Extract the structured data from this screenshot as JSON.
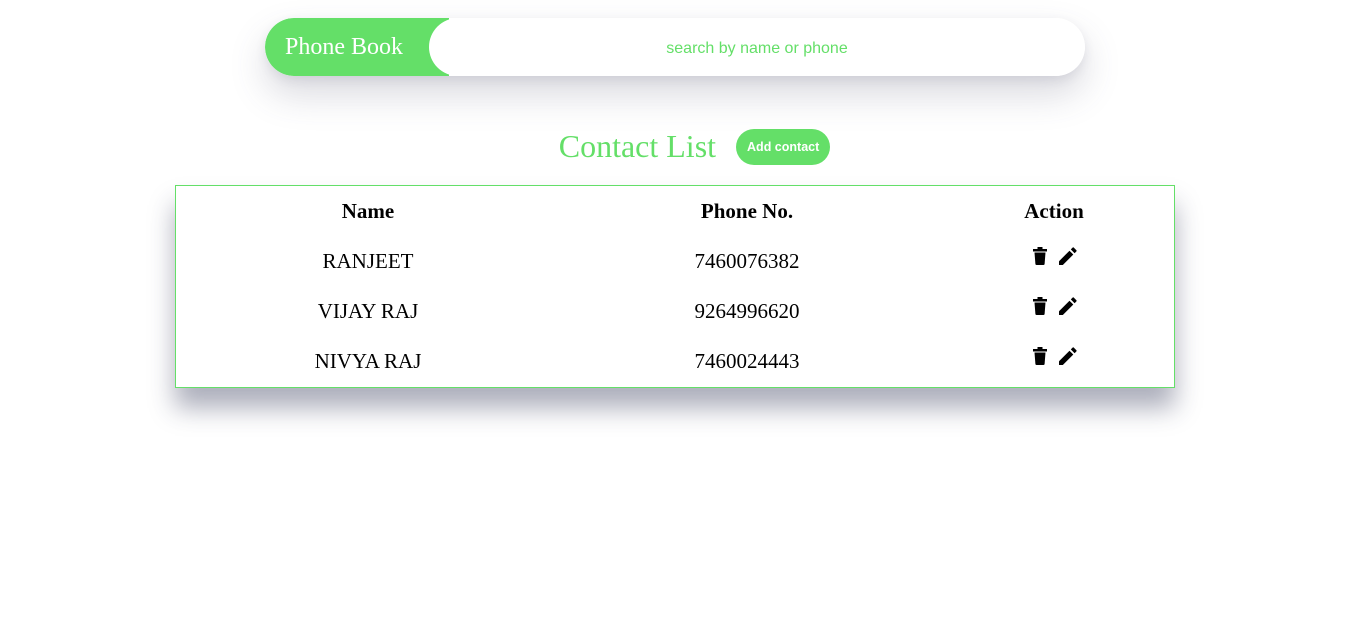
{
  "header": {
    "brand": "Phone Book",
    "search_placeholder": "search by name or phone"
  },
  "list": {
    "title": "Contact List",
    "add_label": "Add contact"
  },
  "table": {
    "columns": [
      "Name",
      "Phone No.",
      "Action"
    ],
    "rows": [
      {
        "name": "RANJEET",
        "phone": "7460076382"
      },
      {
        "name": "VIJAY RAJ",
        "phone": "9264996620"
      },
      {
        "name": "NIVYA RAJ",
        "phone": "7460024443"
      }
    ]
  },
  "icons": {
    "delete": "trash-icon",
    "edit": "pencil-icon"
  },
  "colors": {
    "accent": "#64df68",
    "text": "#000000",
    "background": "#ffffff"
  }
}
